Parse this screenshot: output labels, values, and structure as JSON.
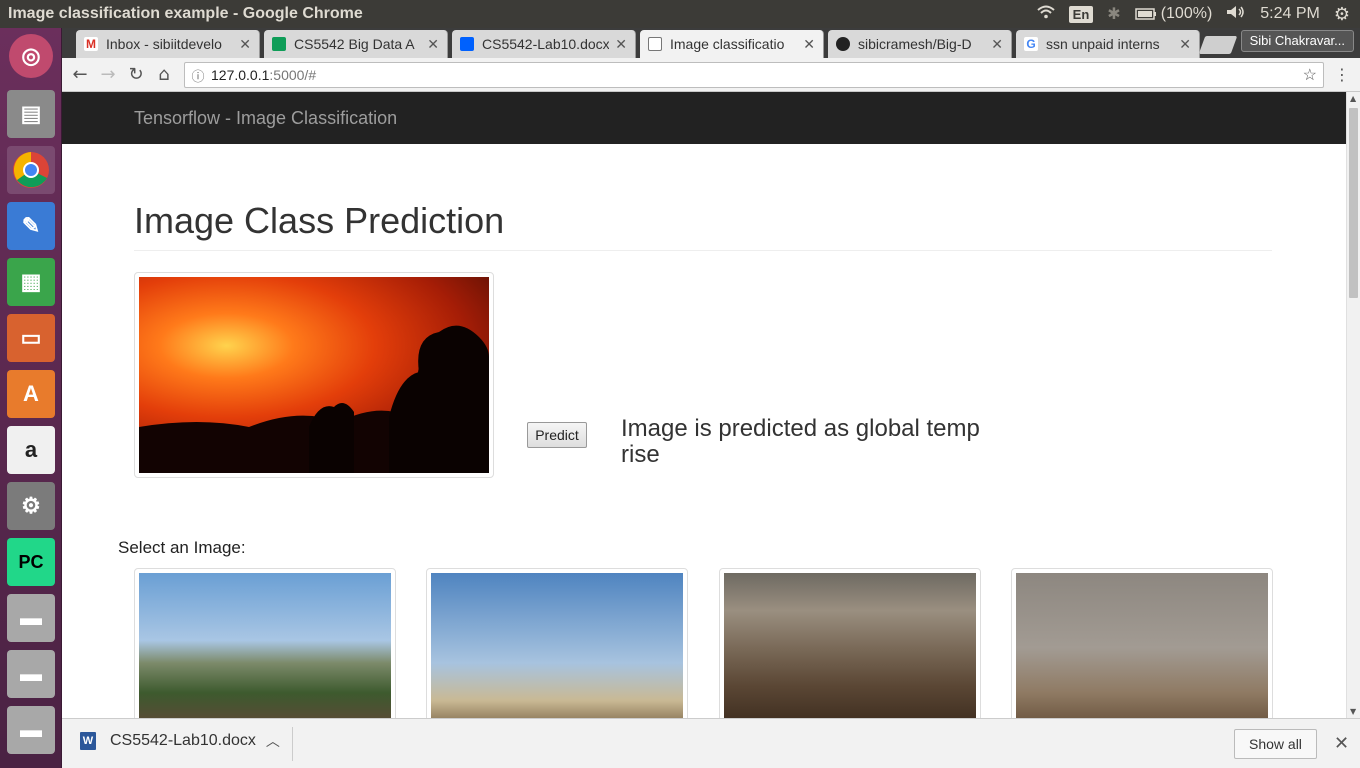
{
  "window": {
    "title": "Image classification example - Google Chrome"
  },
  "tray": {
    "lang": "En",
    "battery": "(100%)",
    "time": "5:24 PM"
  },
  "tabs": [
    {
      "label": "Inbox - sibiitdevelo",
      "icon_color": "#d93025",
      "icon": "gmail-icon"
    },
    {
      "label": "CS5542 Big Data A",
      "icon_color": "#0f9d58",
      "icon": "sheets-icon"
    },
    {
      "label": "CS5542-Lab10.docx",
      "icon_color": "#0061fe",
      "icon": "dropbox-icon"
    },
    {
      "label": "Image classificatio",
      "icon_color": "#888888",
      "icon": "page-icon",
      "active": true
    },
    {
      "label": "sibicramesh/Big-D",
      "icon_color": "#222222",
      "icon": "github-icon"
    },
    {
      "label": "ssn unpaid interns",
      "icon_color": "#4285f4",
      "icon": "google-icon"
    }
  ],
  "profile": {
    "label": "Sibi Chakravar..."
  },
  "address": {
    "host": "127.0.0.1",
    "path": ":5000/#"
  },
  "navbar": {
    "brand": "Tensorflow - Image Classification"
  },
  "main": {
    "heading": "Image Class Prediction",
    "predict_label": "Predict",
    "result": "Image is predicted as global temp rise",
    "select_label": "Select an Image:"
  },
  "download": {
    "filename": "CS5542-Lab10.docx",
    "show_all": "Show all"
  }
}
